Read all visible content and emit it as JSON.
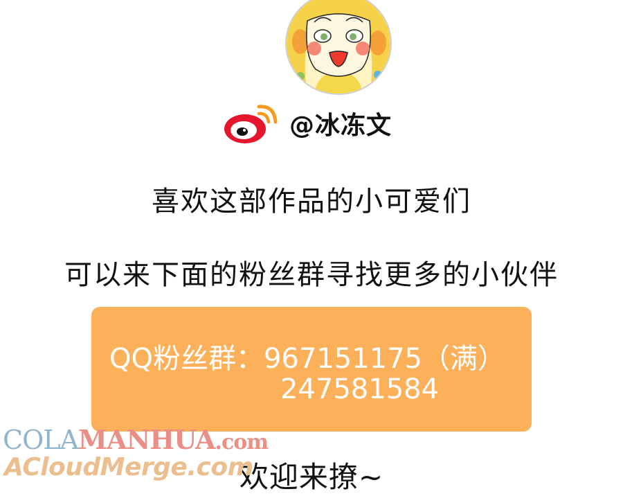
{
  "author": {
    "avatar_icon": "cartoon-girl-avatar",
    "platform_icon": "weibo-logo-icon",
    "handle": "@冰冻文"
  },
  "message": {
    "line1": "喜欢这部作品的小可爱们",
    "line2": "可以来下面的粉丝群寻找更多的小伙伴"
  },
  "qq_group": {
    "line1": "QQ粉丝群：967151175（满）",
    "line2": "247581584",
    "background_color": "#fdb05a"
  },
  "watermark": {
    "site_part1": "COLA",
    "site_part2": "MANHUA",
    "site_part3": ".com",
    "site2": "ACloudMerge.com"
  },
  "closing": "欢迎来撩~"
}
